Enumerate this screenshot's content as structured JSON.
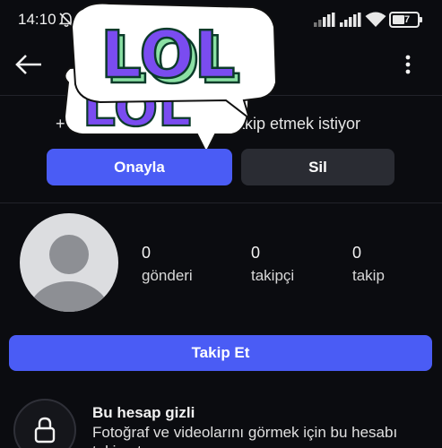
{
  "status_bar": {
    "time": "14:10",
    "battery": "47"
  },
  "request": {
    "prefix": "+",
    "text": "takip etmek istiyor"
  },
  "actions": {
    "approve_label": "Onayla",
    "delete_label": "Sil"
  },
  "profile": {
    "stats": [
      {
        "value": "0",
        "label": "gönderi"
      },
      {
        "value": "0",
        "label": "takipçi"
      },
      {
        "value": "0",
        "label": "takip"
      }
    ],
    "follow_label": "Takip Et"
  },
  "privacy": {
    "title": "Bu hesap gizli",
    "description": "Fotoğraf ve videolarını görmek için bu hesabı takip et."
  },
  "sticker": {
    "front_text": "LOL",
    "back_text": "LOL"
  },
  "colors": {
    "accent": "#4a5cf5",
    "background": "#0b0c10",
    "sticker_purple": "#7a4cf0",
    "sticker_green": "#8be0a4"
  },
  "icons": {
    "back": "arrow-left-icon",
    "more": "more-vertical-icon",
    "lock": "lock-icon",
    "mute": "bell-off-icon",
    "wifi": "wifi-icon"
  }
}
